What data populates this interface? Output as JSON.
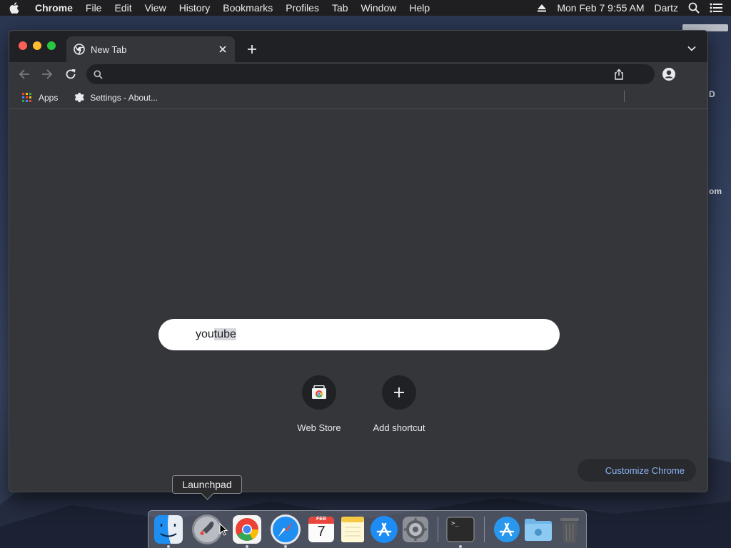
{
  "menubar": {
    "app_name": "Chrome",
    "items": [
      "File",
      "Edit",
      "View",
      "History",
      "Bookmarks",
      "Profiles",
      "Tab",
      "Window",
      "Help"
    ],
    "clock": "Mon Feb 7  9:55 AM",
    "user": "Dartz"
  },
  "desktop": {
    "peek_texts": [
      "D",
      "om"
    ]
  },
  "browser": {
    "tab": {
      "title": "New Tab"
    },
    "omnibox": {
      "value": "",
      "placeholder": ""
    },
    "bookmarks": [
      {
        "label": "Apps",
        "icon": "apps-grid-icon"
      },
      {
        "label": "Settings - About...",
        "icon": "gear-icon"
      }
    ],
    "ntp": {
      "search_value": "youtube",
      "search_value_typed": "you",
      "search_value_suggested": "tube",
      "shortcuts": [
        {
          "label": "Web Store",
          "icon": "web-store-icon"
        },
        {
          "label": "Add shortcut",
          "icon": "plus-icon"
        }
      ],
      "customize_label": "Customize Chrome"
    }
  },
  "tooltip": {
    "text": "Launchpad"
  },
  "dock": {
    "apps": [
      {
        "name": "Finder",
        "icon": "finder-icon",
        "running": true
      },
      {
        "name": "Launchpad",
        "icon": "launchpad-icon",
        "running": false
      },
      {
        "name": "Google Chrome",
        "icon": "chrome-icon",
        "running": true
      },
      {
        "name": "Safari",
        "icon": "safari-icon",
        "running": true
      },
      {
        "name": "Calendar",
        "icon": "calendar-icon",
        "running": false,
        "month": "FEB",
        "day": "7"
      },
      {
        "name": "Notes",
        "icon": "notes-icon",
        "running": false
      },
      {
        "name": "App Store",
        "icon": "app-store-icon",
        "running": false
      },
      {
        "name": "System Preferences",
        "icon": "system-preferences-icon",
        "running": false
      },
      {
        "name": "Terminal",
        "icon": "terminal-icon",
        "running": true,
        "prompt": ">_"
      },
      {
        "name": "Applications",
        "icon": "applications-folder-icon",
        "running": false
      },
      {
        "name": "Downloads",
        "icon": "downloads-folder-icon",
        "running": false
      },
      {
        "name": "Trash",
        "icon": "trash-icon",
        "running": false
      }
    ]
  },
  "colors": {
    "window_bg": "#35363a",
    "tabstrip_bg": "#202124",
    "link_blue": "#8ab4f8",
    "traffic_red": "#ff5f57",
    "traffic_yellow": "#febc2e",
    "traffic_green": "#28c840"
  }
}
